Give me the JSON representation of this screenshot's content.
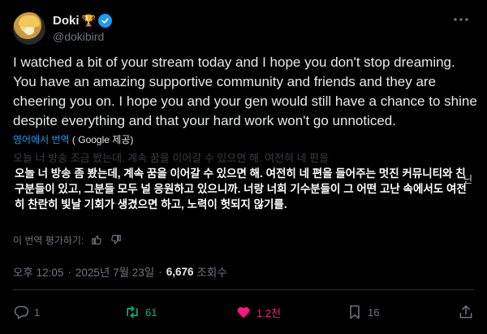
{
  "author": {
    "display_name": "Doki",
    "trophy": "🏆",
    "handle": "@dokibird",
    "avatar_icon": "avatar",
    "verified_color": "#1d9bf0"
  },
  "tweet": {
    "text": "I watched a bit of your stream today and I hope you don't stop dreaming. You have an amazing supportive community and friends and they are cheering you on. I hope you and your gen would still have a chance to shine despite everything and that your hard work won't go unnoticed."
  },
  "translation": {
    "link": "영어에서 번역",
    "provider": "( Google 제공)",
    "ghost_line": "오늘 너 방송 조금 봤는데, 계속 꿈을 이어갈 수 있으면 해. 여전히 네 편을",
    "overlay_text": "오늘 너 방송 좀 봤는데, 계속 꿈을 이어갈 수 있으면 해. 여전히 네 편을 들어주는 멋진 커뮤니티와 친구분들이 있고, 그분들 모두 널 응원하고 있으니까. 너랑 너희 기수분들이 그 어떤 고난 속에서도 여전히 찬란히 빛날 기회가 생겼으면 하고, 노력이 헛되지 않기를.",
    "side_char": "닌",
    "rate_label": "이 번역 평가하기:"
  },
  "meta": {
    "time": "오후 12:05",
    "date": "2025년 7월 23일",
    "views_count": "6,676",
    "views_label": "조회수"
  },
  "actions": {
    "replies": "1",
    "retweets": "61",
    "likes": "1.2천",
    "bookmarks": "16"
  },
  "colors": {
    "background": "#000000",
    "text": "#e7e9ea",
    "muted": "#71767b",
    "link": "#1d9bf0",
    "retweet": "#00ba7c",
    "like": "#f91880"
  }
}
